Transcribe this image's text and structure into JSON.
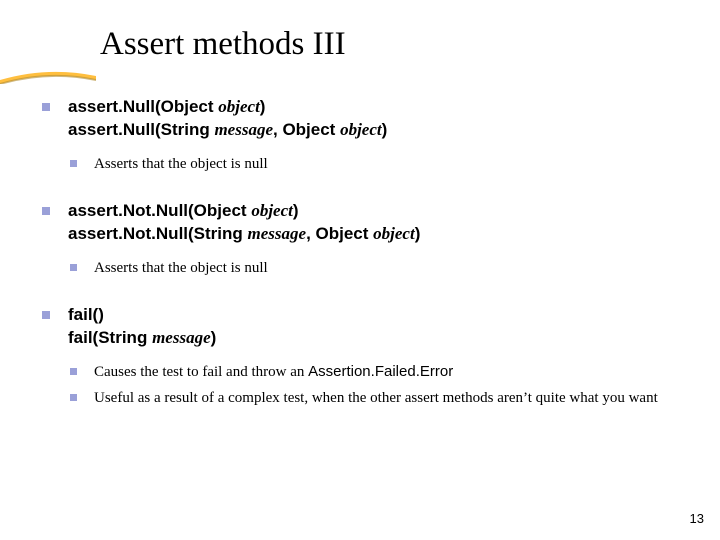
{
  "title": "Assert methods III",
  "colors": {
    "bullet": "#9aa0d8",
    "swoosh_accent": "#ffbf3f",
    "swoosh_dark": "#b08a2f"
  },
  "items": [
    {
      "sig1": [
        {
          "t": "assert",
          "cls": "sans bold"
        },
        {
          "t": ".",
          "cls": "sans bold"
        },
        {
          "t": "Null(Object ",
          "cls": "sans bold"
        },
        {
          "t": "object",
          "cls": "serif ital bold"
        },
        {
          "t": ")",
          "cls": "sans bold"
        }
      ],
      "sig2": [
        {
          "t": "assert",
          "cls": "sans bold"
        },
        {
          "t": ".",
          "cls": "sans bold"
        },
        {
          "t": "Null(String ",
          "cls": "sans bold"
        },
        {
          "t": "message",
          "cls": "serif ital bold"
        },
        {
          "t": ", Object ",
          "cls": "sans bold"
        },
        {
          "t": "object",
          "cls": "serif ital bold"
        },
        {
          "t": ")",
          "cls": "sans bold"
        }
      ],
      "subs": [
        {
          "segs": [
            {
              "t": "Asserts that the object is null",
              "cls": "serif"
            }
          ]
        }
      ]
    },
    {
      "sig1": [
        {
          "t": "assert",
          "cls": "sans bold"
        },
        {
          "t": ".",
          "cls": "sans bold"
        },
        {
          "t": "Not",
          "cls": "sans bold"
        },
        {
          "t": ".",
          "cls": "sans bold"
        },
        {
          "t": "Null(Object ",
          "cls": "sans bold"
        },
        {
          "t": "object",
          "cls": "serif ital bold"
        },
        {
          "t": ")",
          "cls": "sans bold"
        }
      ],
      "sig2": [
        {
          "t": "assert",
          "cls": "sans bold"
        },
        {
          "t": ".",
          "cls": "sans bold"
        },
        {
          "t": "Not",
          "cls": "sans bold"
        },
        {
          "t": ".",
          "cls": "sans bold"
        },
        {
          "t": "Null(String ",
          "cls": "sans bold"
        },
        {
          "t": "message",
          "cls": "serif ital bold"
        },
        {
          "t": ", Object ",
          "cls": "sans bold"
        },
        {
          "t": "object",
          "cls": "serif ital bold"
        },
        {
          "t": ")",
          "cls": "sans bold"
        }
      ],
      "subs": [
        {
          "segs": [
            {
              "t": "Asserts that the object is null",
              "cls": "serif"
            }
          ]
        }
      ]
    },
    {
      "sig1": [
        {
          "t": "fail()",
          "cls": "sans bold"
        }
      ],
      "sig2": [
        {
          "t": "fail(String ",
          "cls": "sans bold"
        },
        {
          "t": "message",
          "cls": "serif ital bold"
        },
        {
          "t": ")",
          "cls": "sans bold"
        }
      ],
      "subs": [
        {
          "segs": [
            {
              "t": "Causes the test to fail and throw an ",
              "cls": "serif"
            },
            {
              "t": "Assertion",
              "cls": "sans"
            },
            {
              "t": ".",
              "cls": "sans"
            },
            {
              "t": "Failed",
              "cls": "sans"
            },
            {
              "t": ".",
              "cls": "sans"
            },
            {
              "t": "Error",
              "cls": "sans"
            }
          ]
        },
        {
          "segs": [
            {
              "t": "Useful as a result of a complex test, when the other assert methods aren’t quite what you want",
              "cls": "serif"
            }
          ]
        }
      ]
    }
  ],
  "page_number": "13"
}
